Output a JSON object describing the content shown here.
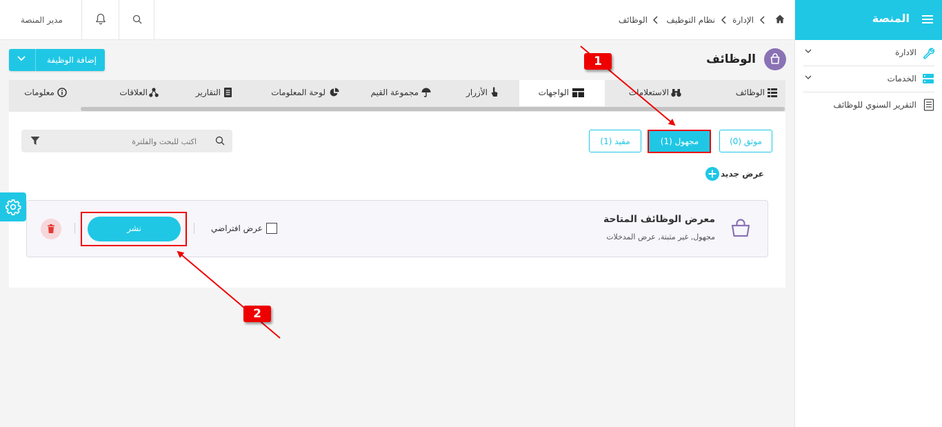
{
  "sidebar": {
    "title": "المنصة",
    "items": [
      {
        "label": "الادارة"
      },
      {
        "label": "الخدمات"
      },
      {
        "label": "التقرير السنوي للوظائف"
      }
    ]
  },
  "topbar": {
    "user": "مدير المنصة",
    "breadcrumb": [
      "الإدارة",
      "نظام التوظيف",
      "الوظائف"
    ]
  },
  "page": {
    "title": "الوظائف",
    "add_button": "إضافة الوظيفة"
  },
  "tabs": [
    {
      "label": "الوظائف"
    },
    {
      "label": "الاستعلامات"
    },
    {
      "label": "الواجهات"
    },
    {
      "label": "الأزرار"
    },
    {
      "label": "مجموعة القيم"
    },
    {
      "label": "لوحة المعلومات"
    },
    {
      "label": "التقارير"
    },
    {
      "label": "العلاقات"
    },
    {
      "label": "معلومات"
    }
  ],
  "filters": [
    {
      "label": "موثق (0)"
    },
    {
      "label": "مجهول (1)"
    },
    {
      "label": "مقيد (1)"
    }
  ],
  "search": {
    "placeholder": "اكتب للبحث والفلترة"
  },
  "new_offer": "عرض جديد",
  "item": {
    "title": "معرض الوظائف المتاحة",
    "subtitle": "مجهول, غير مثبتة, عرض المدخلات",
    "default_label": "عرض افتراضي",
    "publish": "نشر"
  },
  "annotations": [
    "1",
    "2"
  ],
  "colors": {
    "accent": "#1fc7e5",
    "annotation": "#ee0000",
    "brand_icon": "#8a72b5"
  }
}
